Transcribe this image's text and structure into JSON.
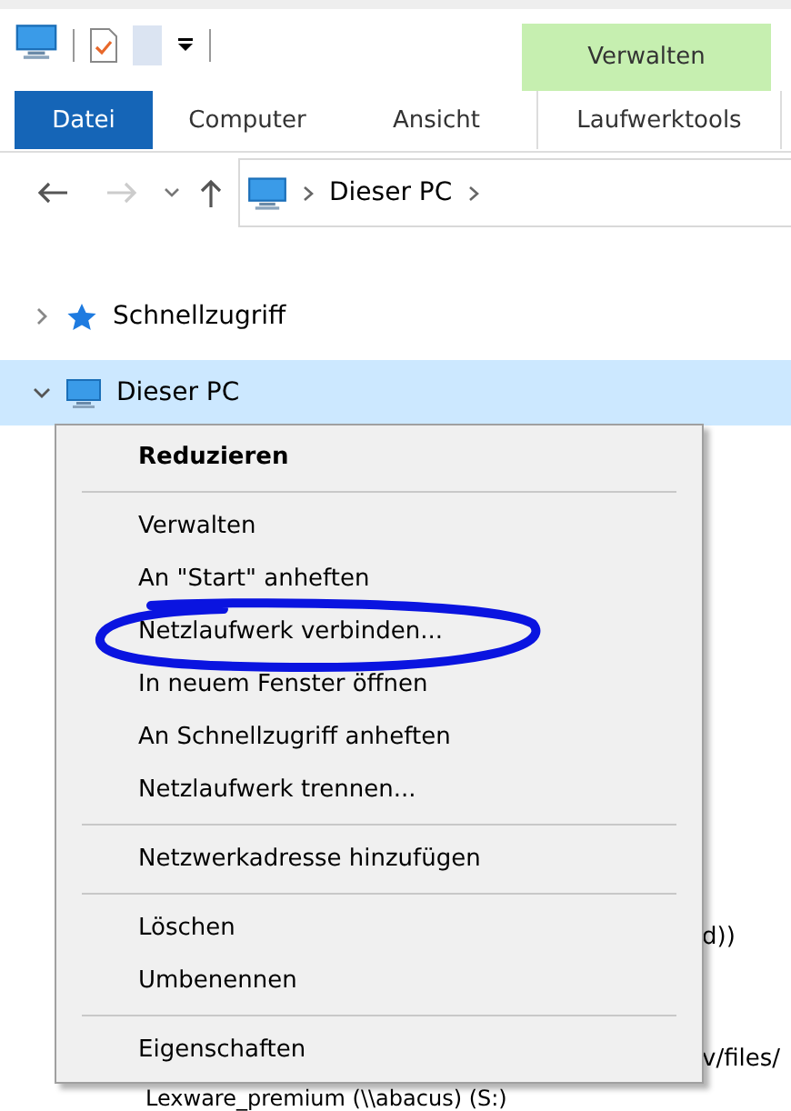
{
  "ribbon": {
    "context_group": "Verwalten",
    "tabs": [
      {
        "label": "Datei",
        "kind": "file",
        "selected": false
      },
      {
        "label": "Computer",
        "kind": "tab",
        "selected": false
      },
      {
        "label": "Ansicht",
        "kind": "tab",
        "selected": false
      },
      {
        "label": "Laufwerktools",
        "kind": "context",
        "selected": false
      }
    ]
  },
  "address_bar": {
    "path": [
      "Dieser PC"
    ]
  },
  "tree": [
    {
      "label": "Schnellzugriff",
      "kind": "star",
      "expanded": false,
      "selected": false
    },
    {
      "label": "Dieser PC",
      "kind": "pc",
      "expanded": true,
      "selected": true
    }
  ],
  "hidden_row_tails": [
    "d))",
    "v/files/"
  ],
  "bottom_row": "Lexware_premium (\\\\abacus) (S:)",
  "context_menu": [
    {
      "kind": "item",
      "label": "Reduzieren",
      "bold": true
    },
    {
      "kind": "separator"
    },
    {
      "kind": "item",
      "label": "Verwalten"
    },
    {
      "kind": "item",
      "label": "An \"Start\" anheften"
    },
    {
      "kind": "item",
      "label": "Netzlaufwerk verbinden...",
      "circled": true
    },
    {
      "kind": "item",
      "label": "In neuem Fenster öffnen"
    },
    {
      "kind": "item",
      "label": "An Schnellzugriff anheften"
    },
    {
      "kind": "item",
      "label": "Netzlaufwerk trennen..."
    },
    {
      "kind": "separator"
    },
    {
      "kind": "item",
      "label": "Netzwerkadresse hinzufügen"
    },
    {
      "kind": "separator"
    },
    {
      "kind": "item",
      "label": "Löschen"
    },
    {
      "kind": "item",
      "label": "Umbenennen"
    },
    {
      "kind": "separator"
    },
    {
      "kind": "item",
      "label": "Eigenschaften"
    }
  ]
}
